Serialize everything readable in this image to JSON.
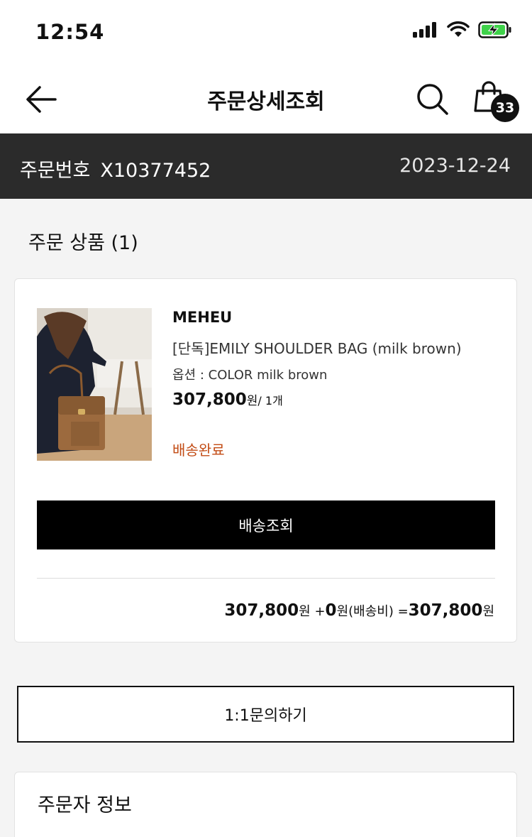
{
  "status_bar": {
    "time": "12:54"
  },
  "header": {
    "title": "주문상세조회",
    "cart_count": "33"
  },
  "order": {
    "label": "주문번호",
    "number": "X10377452",
    "date": "2023-12-24"
  },
  "section": {
    "title": "주문 상품 (1)"
  },
  "product": {
    "brand": "MEHEU",
    "name": "[단독]EMILY SHOULDER BAG (milk brown)",
    "option": "옵션 : COLOR milk brown",
    "price": "307,800",
    "price_unit": "원",
    "quantity": "/ 1개",
    "status": "배송완료",
    "track_button": "배송조회"
  },
  "totals": {
    "item_price": "307,800",
    "item_unit": "원",
    "plus": " +",
    "shipping": "0",
    "shipping_unit": "원(배송비)",
    "equals": " =",
    "total": "307,800",
    "total_unit": "원"
  },
  "inquiry_button": "1:1문의하기",
  "orderer_section": {
    "title": "주문자 정보"
  },
  "colors": {
    "status_accent": "#c24b14",
    "order_bar": "#2b2b2b",
    "battery": "#3fd24a"
  },
  "icons": [
    "signal-icon",
    "wifi-icon",
    "battery-icon",
    "back-arrow-icon",
    "search-icon",
    "shopping-bag-icon",
    "product-photo"
  ]
}
